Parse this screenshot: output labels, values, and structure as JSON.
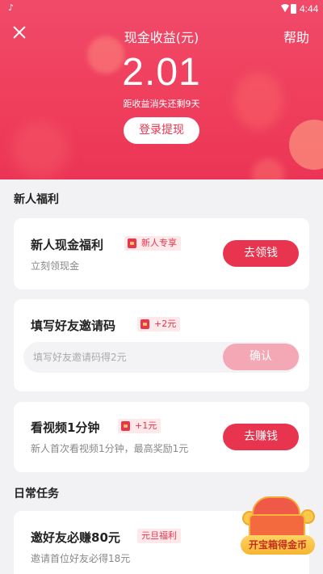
{
  "status_bar": {
    "time": "4:44"
  },
  "header": {
    "title": "现金收益(元)",
    "help": "帮助",
    "amount": "2.01",
    "expiry_note": "距收益消失还剩9天",
    "login_button": "登录提现"
  },
  "new_user": {
    "section_title": "新人福利",
    "cash_card": {
      "title": "新人现金福利",
      "tag": "新人专享",
      "desc": "立刻领现金",
      "button": "去领钱"
    },
    "invite_card": {
      "title": "填写好友邀请码",
      "tag": "+2元",
      "input_placeholder": "填写好友邀请码得2元",
      "button": "确认"
    },
    "video_card": {
      "title": "看视频1分钟",
      "tag": "+1元",
      "desc": "新人首次看视频1分钟，最高奖励1元",
      "button": "去赚钱"
    }
  },
  "daily": {
    "section_title": "日常任务",
    "invite_friends_card": {
      "title": "邀好友必赚80元",
      "tag": "元旦福利",
      "desc": "邀请首位好友必得18元"
    }
  },
  "treasure_box": {
    "label": "开宝箱得金币"
  },
  "colors": {
    "brand": "#e8344f",
    "header_bg": "#ef3f5d",
    "tag_bg": "#fde8ea"
  }
}
